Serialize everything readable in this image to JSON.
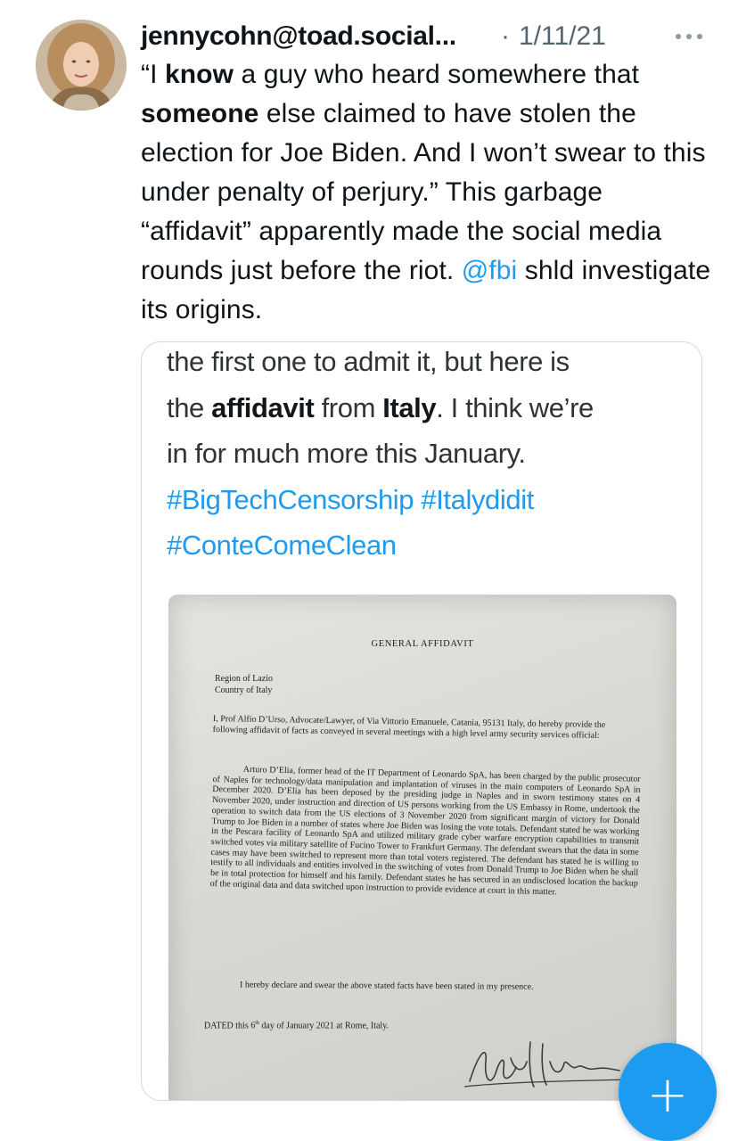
{
  "tweet": {
    "username": "jennycohn@toad.social...",
    "separator": "·",
    "date": "1/11/21",
    "body_segments": [
      {
        "text": "“I ",
        "bold": false
      },
      {
        "text": "know",
        "bold": true
      },
      {
        "text": " a guy who heard somewhere that ",
        "bold": false
      },
      {
        "text": "someone",
        "bold": true
      },
      {
        "text": " else claimed to have stolen the election for Joe Biden. And I won’t swear to this under penalty of perjury.” This garbage “affidavit” apparently made the social media rounds just before the riot. ",
        "bold": false
      }
    ],
    "mention": "@fbi",
    "body_end": " shld investigate its origins."
  },
  "quoted": {
    "line1": "the first one to admit it, but here is",
    "line2_a": "the ",
    "line2_b": "affidavit",
    "line2_c": " from ",
    "line2_d": "Italy",
    "line2_e": ". I think we’re",
    "line3": "in for much more this January.",
    "hashtag1": "#BigTechCensorship",
    "hashtag2": "#Italydidit",
    "hashtag3": "#ConteComeClean"
  },
  "document": {
    "title": "GENERAL AFFIDAVIT",
    "region1": "Region of Lazio",
    "region2": "Country of Italy",
    "intro": "I, Prof Alfio D’Urso, Advocate/Lawyer, of Via Vittorio Emanuele, Catania, 95131 Italy, do hereby provide the following affidavit of facts as conveyed in several meetings with a high level army security services official:",
    "body": "Arturo D’Elia, former head of the IT Department of Leonardo SpA, has been charged by the public prosecutor of Naples for technology/data manipulation and implantation of viruses in the main computers of Leonardo SpA in December 2020. D’Elia has been deposed by the presiding judge in Naples and in sworn testimony states on 4 November 2020, under instruction and direction of US persons working from the US Embassy in Rome, undertook the operation to switch data from the US elections of 3 November 2020 from significant margin of victory for Donald Trump to Joe Biden in a number of states where Joe Biden was losing the vote totals. Defendant stated he was working in the Pescara facility of Leonardo SpA and utilized military grade cyber warfare encryption capabilities to transmit switched votes via military satellite of Fucino Tower to Frankfurt Germany. The defendant swears that the data in some cases may have been switched to represent more than total voters registered. The defendant has stated he is willing to testify to all individuals and entities involved in the switching of votes from Donald Trump to Joe Biden when he shall be in total protection for himself and his family. Defendant states he has secured in an undisclosed location the backup of the original data and data switched upon instruction to provide evidence at court in this matter.",
    "declaration": "I hereby declare and swear the above stated facts have been stated in my presence.",
    "dated_a": "DATED this 6",
    "dated_sup": "th",
    "dated_b": " day of January 2021 at Rome, Italy."
  },
  "fab": {
    "label": "+"
  },
  "colors": {
    "accent": "#1d9bf0",
    "text": "#0f1419",
    "muted": "#536471",
    "border": "#cfd9de"
  }
}
